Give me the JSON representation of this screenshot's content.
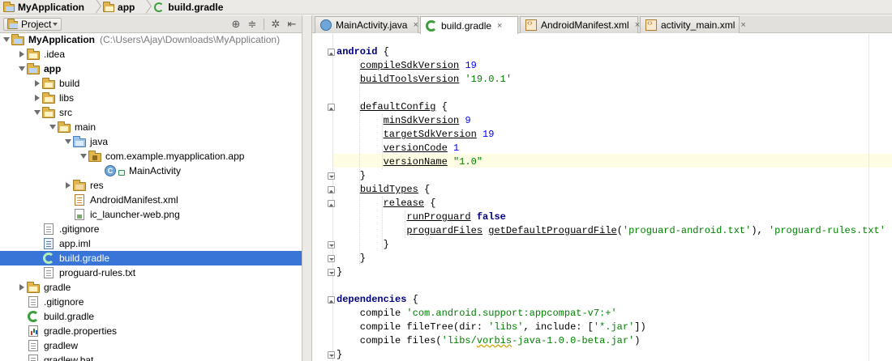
{
  "breadcrumb": [
    {
      "label": "MyApplication",
      "icon": "module-folder-icon"
    },
    {
      "label": "app",
      "icon": "folder-icon"
    },
    {
      "label": "build.gradle",
      "icon": "gradle-icon"
    }
  ],
  "project_panel": {
    "view_selector": "Project",
    "tools": [
      "target-icon",
      "collapse-icon",
      "gear-icon",
      "hide-icon"
    ]
  },
  "tree": [
    {
      "label": "MyApplication",
      "path": "(C:\\Users\\Ajay\\Downloads\\MyApplication)",
      "depth": 0,
      "arrow": "down",
      "icon": "module",
      "bold": true
    },
    {
      "label": ".idea",
      "depth": 1,
      "arrow": "right",
      "icon": "folder"
    },
    {
      "label": "app",
      "depth": 1,
      "arrow": "down",
      "icon": "module",
      "bold": true
    },
    {
      "label": "build",
      "depth": 2,
      "arrow": "right",
      "icon": "folder"
    },
    {
      "label": "libs",
      "depth": 2,
      "arrow": "right",
      "icon": "folder"
    },
    {
      "label": "src",
      "depth": 2,
      "arrow": "down",
      "icon": "folder"
    },
    {
      "label": "main",
      "depth": 3,
      "arrow": "down",
      "icon": "folder"
    },
    {
      "label": "java",
      "depth": 4,
      "arrow": "down",
      "icon": "java"
    },
    {
      "label": "com.example.myapplication.app",
      "depth": 5,
      "arrow": "down",
      "icon": "pkg"
    },
    {
      "label": "MainActivity",
      "depth": 6,
      "arrow": "none",
      "icon": "class"
    },
    {
      "label": "res",
      "depth": 4,
      "arrow": "right",
      "icon": "res"
    },
    {
      "label": "AndroidManifest.xml",
      "depth": 4,
      "arrow": "none",
      "icon": "xml"
    },
    {
      "label": "ic_launcher-web.png",
      "depth": 4,
      "arrow": "none",
      "icon": "img"
    },
    {
      "label": ".gitignore",
      "depth": 2,
      "arrow": "none",
      "icon": "file"
    },
    {
      "label": "app.iml",
      "depth": 2,
      "arrow": "none",
      "icon": "iml"
    },
    {
      "label": "build.gradle",
      "depth": 2,
      "arrow": "none",
      "icon": "gradle",
      "selected": true
    },
    {
      "label": "proguard-rules.txt",
      "depth": 2,
      "arrow": "none",
      "icon": "file"
    },
    {
      "label": "gradle",
      "depth": 1,
      "arrow": "right",
      "icon": "folder"
    },
    {
      "label": ".gitignore",
      "depth": 1,
      "arrow": "none",
      "icon": "file"
    },
    {
      "label": "build.gradle",
      "depth": 1,
      "arrow": "none",
      "icon": "gradle"
    },
    {
      "label": "gradle.properties",
      "depth": 1,
      "arrow": "none",
      "icon": "props"
    },
    {
      "label": "gradlew",
      "depth": 1,
      "arrow": "none",
      "icon": "file"
    },
    {
      "label": "gradlew.bat",
      "depth": 1,
      "arrow": "none",
      "icon": "file"
    }
  ],
  "tabs": [
    {
      "label": "MainActivity.java",
      "icon": "java",
      "active": false
    },
    {
      "label": "build.gradle",
      "icon": "gradle",
      "active": true
    },
    {
      "label": "AndroidManifest.xml",
      "icon": "xml",
      "active": false
    },
    {
      "label": "activity_main.xml",
      "icon": "xml",
      "active": false
    }
  ],
  "tab_close_glyph": "×",
  "code": [
    [
      [
        "k",
        "android"
      ],
      [
        "p",
        " {"
      ]
    ],
    [
      [
        "p",
        "    "
      ],
      [
        "m",
        "compileSdkVersion"
      ],
      [
        "p",
        " "
      ],
      [
        "n",
        "19"
      ]
    ],
    [
      [
        "p",
        "    "
      ],
      [
        "m",
        "buildToolsVersion"
      ],
      [
        "p",
        " "
      ],
      [
        "s",
        "'19.0.1'"
      ]
    ],
    [],
    [
      [
        "p",
        "    "
      ],
      [
        "m",
        "defaultConfig"
      ],
      [
        "p",
        " {"
      ]
    ],
    [
      [
        "p",
        "        "
      ],
      [
        "m",
        "minSdkVersion"
      ],
      [
        "p",
        " "
      ],
      [
        "n",
        "9"
      ]
    ],
    [
      [
        "p",
        "        "
      ],
      [
        "m",
        "targetSdkVersion"
      ],
      [
        "p",
        " "
      ],
      [
        "n",
        "19"
      ]
    ],
    [
      [
        "p",
        "        "
      ],
      [
        "m",
        "versionCode"
      ],
      [
        "p",
        " "
      ],
      [
        "n",
        "1"
      ]
    ],
    [
      [
        "p",
        "        "
      ],
      [
        "m",
        "versionName"
      ],
      [
        "p",
        " "
      ],
      [
        "s",
        "\"1.0\""
      ]
    ],
    [
      [
        "p",
        "    }"
      ]
    ],
    [
      [
        "p",
        "    "
      ],
      [
        "m",
        "buildTypes"
      ],
      [
        "p",
        " {"
      ]
    ],
    [
      [
        "p",
        "        "
      ],
      [
        "m",
        "release"
      ],
      [
        "p",
        " {"
      ]
    ],
    [
      [
        "p",
        "            "
      ],
      [
        "m",
        "runProguard"
      ],
      [
        "p",
        " "
      ],
      [
        "k",
        "false"
      ]
    ],
    [
      [
        "p",
        "            "
      ],
      [
        "m",
        "proguardFiles"
      ],
      [
        "p",
        " "
      ],
      [
        "m",
        "getDefaultProguardFile"
      ],
      [
        "p",
        "("
      ],
      [
        "s",
        "'proguard-android.txt'"
      ],
      [
        "p",
        "), "
      ],
      [
        "s",
        "'proguard-rules.txt'"
      ]
    ],
    [
      [
        "p",
        "        }"
      ]
    ],
    [
      [
        "p",
        "    }"
      ]
    ],
    [
      [
        "p",
        "}"
      ]
    ],
    [],
    [
      [
        "k",
        "dependencies"
      ],
      [
        "p",
        " {"
      ]
    ],
    [
      [
        "p",
        "    compile "
      ],
      [
        "s",
        "'com.android.support:appcompat-v7:+'"
      ]
    ],
    [
      [
        "p",
        "    compile fileTree(dir: "
      ],
      [
        "s",
        "'libs'"
      ],
      [
        "p",
        ", include: ["
      ],
      [
        "s",
        "'*.jar'"
      ],
      [
        "p",
        "])"
      ]
    ],
    [
      [
        "p",
        "    compile files("
      ],
      [
        "s",
        "'libs/"
      ],
      [
        "sq",
        "vorbis"
      ],
      [
        "s",
        "-java-1.0.0-beta.jar'"
      ],
      [
        "p",
        ")"
      ]
    ],
    [
      [
        "p",
        "}"
      ]
    ]
  ]
}
